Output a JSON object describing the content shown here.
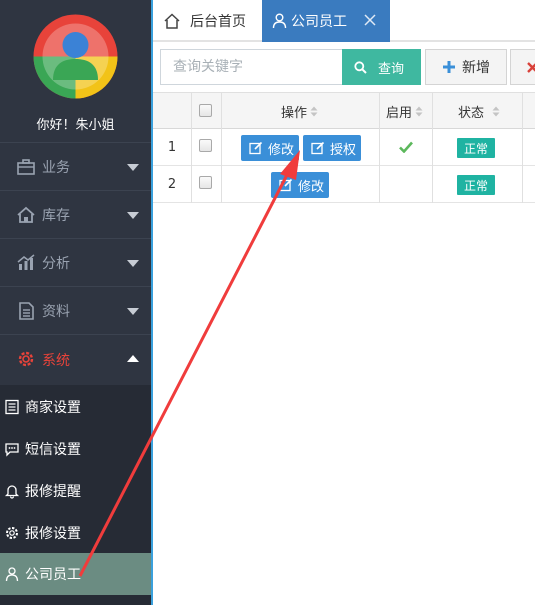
{
  "sidebar": {
    "greeting": "你好！朱小姐",
    "menu": [
      {
        "label": "业务",
        "icon": "briefcase-icon"
      },
      {
        "label": "库存",
        "icon": "house-icon"
      },
      {
        "label": "分析",
        "icon": "chart-icon"
      },
      {
        "label": "资料",
        "icon": "document-icon"
      },
      {
        "label": "系统",
        "icon": "gear-icon",
        "active": true
      }
    ],
    "submenu": [
      {
        "label": "商家设置",
        "icon": "list-icon"
      },
      {
        "label": "短信设置",
        "icon": "chat-icon"
      },
      {
        "label": "报修提醒",
        "icon": "bell-icon"
      },
      {
        "label": "报修设置",
        "icon": "gear-icon"
      },
      {
        "label": "公司员工",
        "icon": "user-icon",
        "selected": true
      }
    ]
  },
  "tabs": {
    "home": "后台首页",
    "staff": "公司员工"
  },
  "toolbar": {
    "search_placeholder": "查询关键字",
    "query_label": "查询",
    "add_label": "新增"
  },
  "table": {
    "headers": {
      "operation": "操作",
      "enabled": "启用",
      "status": "状态"
    },
    "rows": [
      {
        "num": "1",
        "edit": "修改",
        "authorize": "授权",
        "enabled": true,
        "status": "正常"
      },
      {
        "num": "2",
        "edit": "修改",
        "enabled": false,
        "status": "正常"
      }
    ]
  },
  "colors": {
    "sidebar_bg": "#2f3541",
    "active_red": "#e8433a",
    "tab_blue": "#3a7bbf",
    "query_teal": "#3fb8a0",
    "op_button_blue": "#3a8fd8",
    "status_teal": "#1fb3a2",
    "selected_item": "#6b8c82",
    "annotation_arrow": "#f03c3c"
  }
}
